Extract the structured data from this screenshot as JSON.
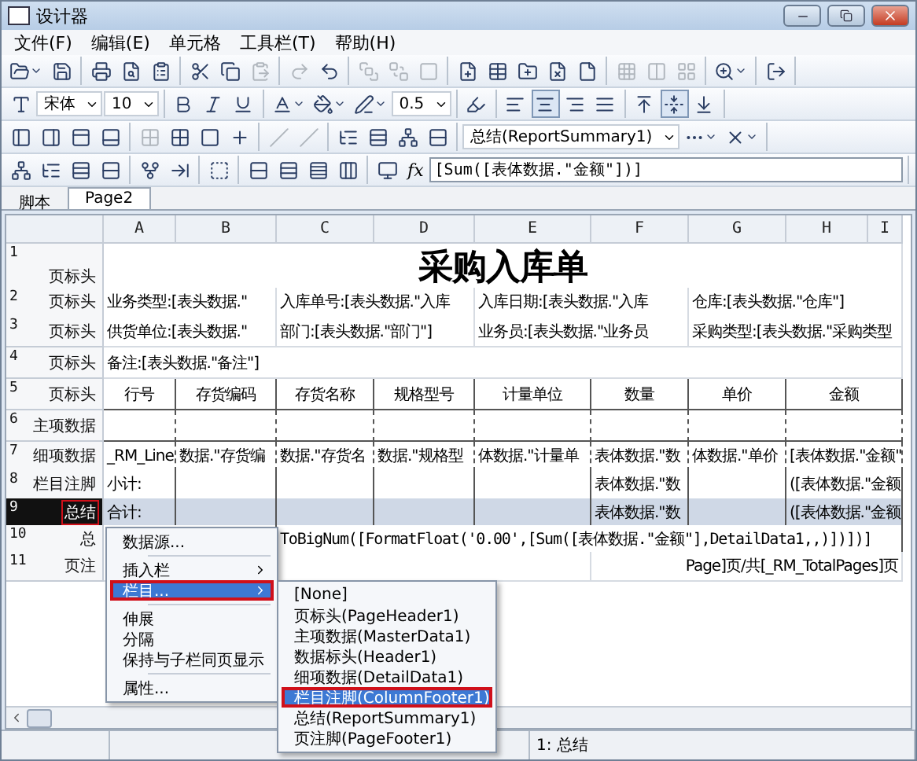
{
  "window": {
    "title": "设计器"
  },
  "menu": [
    {
      "label": "文件(F)"
    },
    {
      "label": "编辑(E)"
    },
    {
      "label": "单元格"
    },
    {
      "label": "工具栏(T)"
    },
    {
      "label": "帮助(H)"
    }
  ],
  "toolbars": [
    [
      [
        {
          "kind": "menu-button",
          "disabled": false,
          "selected": false
        },
        {
          "kind": "button",
          "disabled": false,
          "selected": false
        }
      ],
      [
        {
          "kind": "button",
          "disabled": false,
          "selected": false
        },
        {
          "kind": "button",
          "disabled": false,
          "selected": false
        },
        {
          "kind": "button",
          "disabled": false,
          "selected": false
        }
      ],
      [
        {
          "kind": "button",
          "disabled": false,
          "selected": false
        },
        {
          "kind": "button",
          "disabled": false,
          "selected": false
        },
        {
          "kind": "button",
          "disabled": true,
          "selected": false
        }
      ],
      [
        {
          "kind": "button",
          "disabled": true,
          "selected": false
        },
        {
          "kind": "button",
          "disabled": false,
          "selected": false
        }
      ],
      [
        {
          "kind": "button",
          "disabled": true,
          "selected": false
        },
        {
          "kind": "button",
          "disabled": true,
          "selected": false
        },
        {
          "kind": "button",
          "disabled": true,
          "selected": false
        }
      ],
      [
        {
          "kind": "button",
          "disabled": false,
          "selected": false
        },
        {
          "kind": "button",
          "disabled": false,
          "selected": false
        },
        {
          "kind": "button",
          "disabled": false,
          "selected": false
        },
        {
          "kind": "button",
          "disabled": false,
          "selected": false
        },
        {
          "kind": "button",
          "disabled": false,
          "selected": false
        }
      ],
      [
        {
          "kind": "button",
          "disabled": true,
          "selected": false
        },
        {
          "kind": "button",
          "disabled": true,
          "selected": false
        },
        {
          "kind": "button",
          "disabled": true,
          "selected": false
        }
      ],
      [
        {
          "kind": "menu-button",
          "disabled": false,
          "selected": false
        }
      ],
      [
        {
          "kind": "button",
          "disabled": false,
          "selected": false
        }
      ]
    ],
    [
      [
        {
          "kind": "button",
          "disabled": false,
          "selected": false
        },
        {
          "kind": "select",
          "value": "宋体"
        },
        {
          "kind": "select",
          "value": "10"
        }
      ],
      [
        {
          "kind": "button",
          "disabled": false,
          "selected": false
        },
        {
          "kind": "button",
          "disabled": false,
          "selected": false
        },
        {
          "kind": "button",
          "disabled": false,
          "selected": false
        }
      ],
      [
        {
          "kind": "menu-button",
          "disabled": false,
          "selected": false
        },
        {
          "kind": "menu-button",
          "disabled": false,
          "selected": false
        },
        {
          "kind": "menu-button",
          "disabled": false,
          "selected": false
        },
        {
          "kind": "select",
          "value": "0.5"
        }
      ],
      [
        {
          "kind": "button",
          "disabled": false,
          "selected": false
        }
      ],
      [
        {
          "kind": "button",
          "disabled": false,
          "selected": false
        },
        {
          "kind": "button",
          "disabled": false,
          "selected": true
        },
        {
          "kind": "button",
          "disabled": false,
          "selected": false
        },
        {
          "kind": "button",
          "disabled": false,
          "selected": false
        }
      ],
      [
        {
          "kind": "button",
          "disabled": false,
          "selected": false
        },
        {
          "kind": "button",
          "disabled": false,
          "selected": true
        },
        {
          "kind": "button",
          "disabled": false,
          "selected": false
        }
      ]
    ],
    [
      [
        {
          "kind": "button",
          "disabled": false,
          "selected": false
        },
        {
          "kind": "button",
          "disabled": false,
          "selected": false
        },
        {
          "kind": "button",
          "disabled": false,
          "selected": false
        },
        {
          "kind": "button",
          "disabled": false,
          "selected": false
        }
      ],
      [
        {
          "kind": "button",
          "disabled": true,
          "selected": false
        },
        {
          "kind": "button",
          "disabled": false,
          "selected": false
        },
        {
          "kind": "button",
          "disabled": false,
          "selected": false
        },
        {
          "kind": "button",
          "disabled": false,
          "selected": false
        }
      ],
      [
        {
          "kind": "button",
          "disabled": true,
          "selected": false
        },
        {
          "kind": "button",
          "disabled": true,
          "selected": false
        }
      ],
      [
        {
          "kind": "button",
          "disabled": false,
          "selected": false
        },
        {
          "kind": "button",
          "disabled": false,
          "selected": false
        },
        {
          "kind": "button",
          "disabled": false,
          "selected": false
        },
        {
          "kind": "button",
          "disabled": false,
          "selected": false
        }
      ],
      [
        {
          "kind": "select",
          "value": "总结(ReportSummary1)"
        },
        {
          "kind": "menu-button",
          "disabled": false,
          "selected": false
        },
        {
          "kind": "menu-button",
          "disabled": false,
          "selected": false
        }
      ]
    ],
    [
      [
        {
          "kind": "button",
          "disabled": false,
          "selected": false
        },
        {
          "kind": "button",
          "disabled": false,
          "selected": false
        },
        {
          "kind": "button",
          "disabled": false,
          "selected": false
        },
        {
          "kind": "button",
          "disabled": false,
          "selected": false
        }
      ],
      [
        {
          "kind": "button",
          "disabled": false,
          "selected": false
        },
        {
          "kind": "button",
          "disabled": false,
          "selected": false
        }
      ],
      [
        {
          "kind": "button",
          "disabled": false,
          "selected": false
        }
      ],
      [
        {
          "kind": "button",
          "disabled": false,
          "selected": false
        },
        {
          "kind": "button",
          "disabled": false,
          "selected": false
        },
        {
          "kind": "button",
          "disabled": false,
          "selected": false
        },
        {
          "kind": "button",
          "disabled": false,
          "selected": false
        }
      ],
      [
        {
          "kind": "button",
          "disabled": false,
          "selected": false
        },
        {
          "kind": "label",
          "text": "fx"
        },
        {
          "kind": "field",
          "value": "[Sum([表体数据.\"金额\"])]"
        }
      ]
    ]
  ],
  "tabs": [
    {
      "label": "脚本",
      "selected": false
    },
    {
      "label": "Page2",
      "selected": true
    }
  ],
  "grid": {
    "columns": [
      "A",
      "B",
      "C",
      "D",
      "E",
      "F",
      "G",
      "H",
      "I"
    ],
    "rows": [
      {
        "number": "1",
        "band": "页标头",
        "kind": "title",
        "selected": false,
        "outlined": false,
        "cells": [
          "采购入库单"
        ]
      },
      {
        "number": "2",
        "band": "页标头",
        "kind": "fields",
        "selected": false,
        "outlined": false,
        "cells": [
          "业务类型:[表头数据.\"",
          "入库单号:[表头数据.\"入库",
          "入库日期:[表头数据.\"入库",
          "仓库:[表头数据.\"仓库\"]"
        ]
      },
      {
        "number": "3",
        "band": "页标头",
        "kind": "fields",
        "selected": false,
        "outlined": false,
        "cells": [
          "供货单位:[表头数据.\"",
          "部门:[表头数据.\"部门\"]",
          "业务员:[表头数据.\"业务员",
          "采购类型:[表头数据.\"采购类型"
        ]
      },
      {
        "number": "4",
        "band": "页标头",
        "kind": "fields",
        "selected": false,
        "outlined": false,
        "cells": [
          "备注:[表头数据.\"备注\"]"
        ]
      },
      {
        "number": "5",
        "band": "页标头",
        "kind": "header",
        "selected": false,
        "outlined": false,
        "cells": [
          "行号",
          "存货编码",
          "存货名称",
          "规格型号",
          "计量单位",
          "数量",
          "单价",
          "金额"
        ]
      },
      {
        "number": "6",
        "band": "主项数据",
        "kind": "data",
        "selected": false,
        "outlined": false
      },
      {
        "number": "7",
        "band": "细项数据",
        "kind": "data",
        "selected": false,
        "outlined": false,
        "cells": [
          "_RM_Line",
          "数据.\"存货编",
          "数据.\"存货名",
          "数据.\"规格型",
          "体数据.\"计量单",
          "表体数据.\"数",
          "体数据.\"单价",
          "[表体数据.\"金额\""
        ]
      },
      {
        "number": "8",
        "band": "栏目注脚",
        "kind": "footer",
        "selected": false,
        "outlined": false,
        "cells": [
          "小计:",
          "表体数据.\"数",
          "([表体数据.\"金额"
        ]
      },
      {
        "number": "9",
        "band": "总结",
        "kind": "footer",
        "selected": true,
        "outlined": true,
        "cells": [
          "合计:",
          "表体数据.\"数",
          "([表体数据.\"金额"
        ]
      },
      {
        "number": "10",
        "band": "总",
        "kind": "formula",
        "selected": false,
        "outlined": false,
        "cells": [
          "ToBigNum([FormatFloat('0.00',[Sum([表体数据.\"金额\"],DetailData1,,)])])]"
        ]
      },
      {
        "number": "11",
        "band": "页注",
        "kind": "fields",
        "selected": false,
        "outlined": false,
        "cells": [
          "Page]页/共[_RM_TotalPages]页"
        ]
      }
    ]
  },
  "context_menu": {
    "groups": [
      [
        {
          "label": "数据源...",
          "submenu": false,
          "selected": false,
          "outlined": false
        }
      ],
      [
        {
          "label": "插入栏",
          "submenu": true,
          "selected": false,
          "outlined": false
        },
        {
          "label": "栏目...",
          "submenu": true,
          "selected": true,
          "outlined": true
        }
      ],
      [
        {
          "label": "伸展",
          "submenu": false,
          "selected": false,
          "outlined": false
        },
        {
          "label": "分隔",
          "submenu": false,
          "selected": false,
          "outlined": false
        },
        {
          "label": "保持与子栏同页显示",
          "submenu": false,
          "selected": false,
          "outlined": false
        }
      ],
      [
        {
          "label": "属性...",
          "submenu": false,
          "selected": false,
          "outlined": false
        }
      ]
    ]
  },
  "submenu": {
    "items": [
      {
        "label": "[None]",
        "selected": false,
        "outlined": false
      },
      {
        "label": "页标头(PageHeader1)",
        "selected": false,
        "outlined": false
      },
      {
        "label": "主项数据(MasterData1)",
        "selected": false,
        "outlined": false
      },
      {
        "label": "数据标头(Header1)",
        "selected": false,
        "outlined": false
      },
      {
        "label": "细项数据(DetailData1)",
        "selected": false,
        "outlined": false
      },
      {
        "label": "栏目注脚(ColumnFooter1)",
        "selected": true,
        "outlined": true
      },
      {
        "label": "总结(ReportSummary1)",
        "selected": false,
        "outlined": false
      },
      {
        "label": "页注脚(PageFooter1)",
        "selected": false,
        "outlined": false
      }
    ]
  },
  "status_bar": {
    "text": "1: 总结"
  }
}
